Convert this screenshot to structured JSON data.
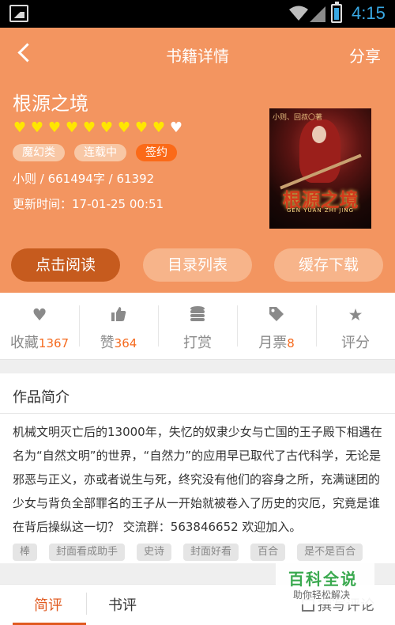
{
  "status_bar": {
    "time": "4:15"
  },
  "topbar": {
    "title": "书籍详情",
    "share_label": "分享"
  },
  "book": {
    "title": "根源之境",
    "rating_stars_filled": 9,
    "rating_stars_total": 10,
    "tags": [
      "魔幻类",
      "连载中",
      "签约"
    ],
    "meta_line": "小则 / 661494字 / 61392",
    "updated": "更新时间：17-01-25 00:51",
    "cover": {
      "author_text": "小则、回叔〇著",
      "title_text": "根源之境",
      "pinyin": "GEN YUAN ZHI JING"
    }
  },
  "buttons": {
    "read": "点击阅读",
    "toc": "目录列表",
    "cache": "缓存下载"
  },
  "actions": [
    {
      "label": "收藏",
      "count": "1367",
      "icon": "heart-icon"
    },
    {
      "label": "赞",
      "count": "364",
      "icon": "thumbs-up-icon"
    },
    {
      "label": "打赏",
      "count": "",
      "icon": "coins-icon"
    },
    {
      "label": "月票",
      "count": "8",
      "icon": "ticket-tag-icon"
    },
    {
      "label": "评分",
      "count": "",
      "icon": "star-icon"
    }
  ],
  "summary": {
    "title": "作品简介",
    "text": "机械文明灭亡后的13000年，失忆的奴隶少女与亡国的王子殿下相遇在名为“自然文明”的世界，“自然力”的应用早已取代了古代科学，无论是邪恶与正义，亦或者说生与死，终究没有他们的容身之所，充满谜团的少女与背负全部罪名的王子从一开始就被卷入了历史的灾厄，究竟是谁在背后操纵这一切？ 交流群：563846652 欢迎加入。",
    "keywords": [
      "棒",
      "封面看成助手",
      "史诗",
      "封面好看",
      "百合",
      "是不是百合"
    ]
  },
  "tabs": {
    "short_review": "简评",
    "book_review": "书评",
    "write_review": "撰写评论"
  },
  "watermark": {
    "main": "百科全说",
    "sub": "助你轻松解决"
  },
  "colors": {
    "header_bg": "#f39560",
    "accent": "#f56a1e",
    "star": "#ffe600"
  }
}
